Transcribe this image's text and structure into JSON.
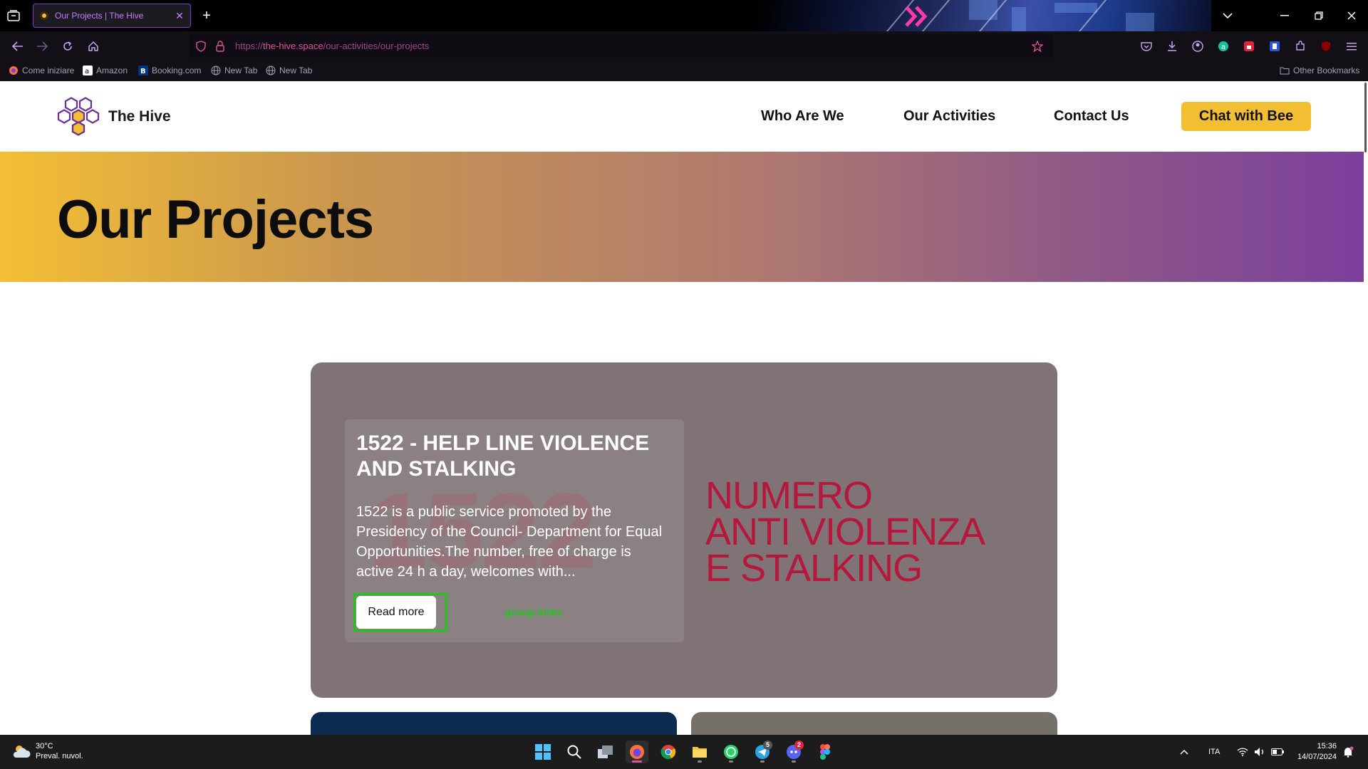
{
  "browser": {
    "tab": {
      "title": "Our Projects | The Hive"
    },
    "url": {
      "scheme": "https://",
      "domain": "the-hive.space",
      "path": "/our-activities/our-projects"
    },
    "bookmarks": [
      {
        "label": "Come iniziare",
        "icon": "firefox-icon"
      },
      {
        "label": "Amazon",
        "icon": "amazon-icon"
      },
      {
        "label": "Booking.com",
        "icon": "booking-icon"
      },
      {
        "label": "New Tab",
        "icon": "globe-icon"
      },
      {
        "label": "New Tab",
        "icon": "globe-icon"
      }
    ],
    "other_bookmarks": "Other Bookmarks",
    "colors": {
      "accent": "#e0529c",
      "tab_border": "#7b3cc7"
    }
  },
  "site": {
    "brand": "The Hive",
    "nav": [
      {
        "label": "Who Are We"
      },
      {
        "label": "Our Activities"
      },
      {
        "label": "Contact Us"
      }
    ],
    "cta": "Chat with Bee",
    "colors": {
      "brand_yellow": "#f2be32",
      "brand_purple": "#7b3f9d"
    }
  },
  "hero": {
    "title": "Our Projects"
  },
  "project": {
    "title": "1522 - HELP LINE VIOLENCE AND STALKING",
    "description": "1522 is a public service promoted by the Presidency of the Council- Department for Equal Opportunities.The number, free of charge is active 24 h a day, welcomes with...",
    "read_more": "Read more",
    "image_text": "NUMERO\nANTI VIOLENZA\nE STALKING",
    "debug_label": "group links"
  },
  "taskbar": {
    "weather": {
      "temp": "30°C",
      "desc": "Preval. nuvol."
    },
    "apps": [
      {
        "name": "start-icon"
      },
      {
        "name": "search-icon"
      },
      {
        "name": "task-view-icon"
      },
      {
        "name": "firefox-icon",
        "active": true
      },
      {
        "name": "chrome-icon"
      },
      {
        "name": "file-explorer-icon"
      },
      {
        "name": "whatsapp-icon"
      },
      {
        "name": "telegram-icon",
        "badge": "5"
      },
      {
        "name": "discord-icon",
        "badge": "2"
      },
      {
        "name": "figma-icon"
      }
    ],
    "language": "ITA",
    "time": "15:36",
    "date": "14/07/2024"
  }
}
